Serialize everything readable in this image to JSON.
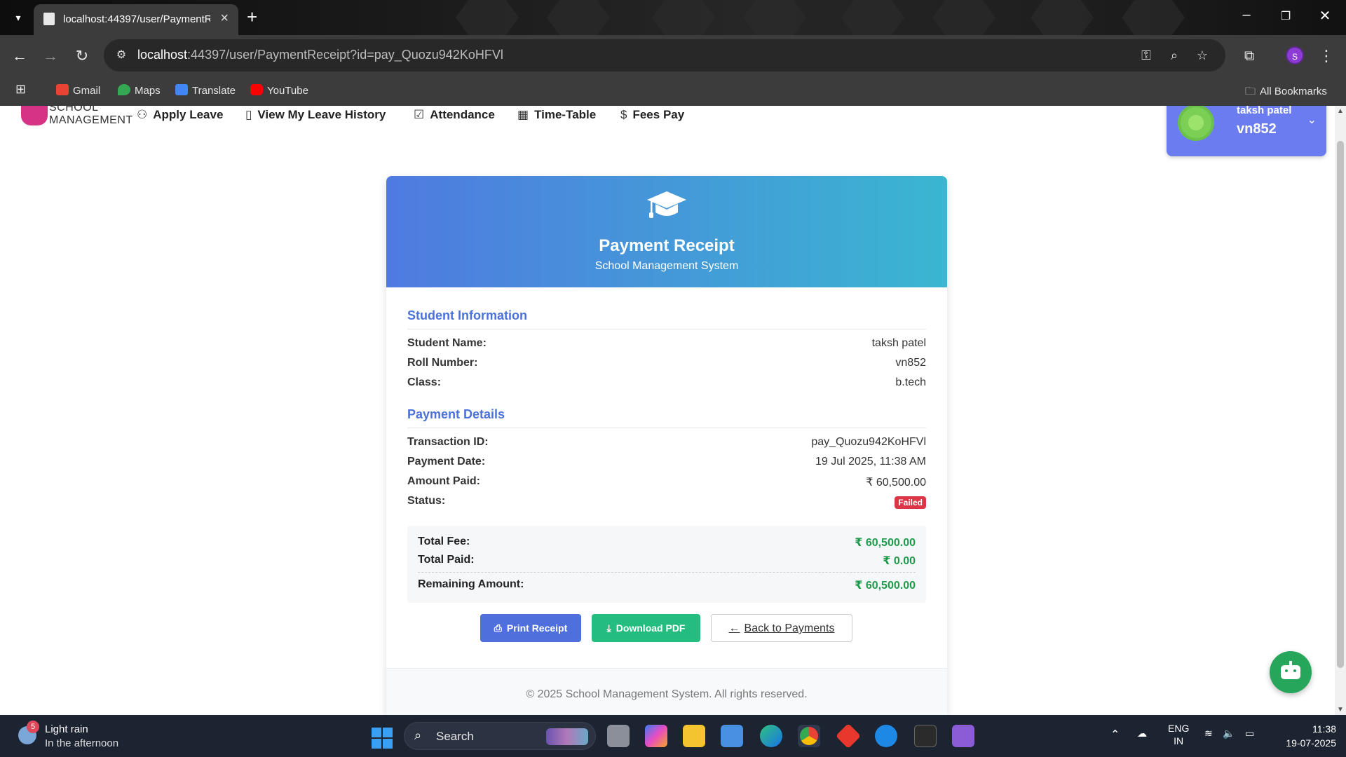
{
  "browser": {
    "tab_title": "localhost:44397/user/PaymentR",
    "url_host": "localhost",
    "url_rest": ":44397/user/PaymentReceipt?id=pay_Quozu942KoHFVl",
    "profile_initial": "S",
    "bookmarks": [
      "Gmail",
      "Maps",
      "Translate",
      "YouTube"
    ],
    "all_bookmarks": "All Bookmarks"
  },
  "app": {
    "logo_line1": "SCHOOL",
    "logo_line2": "MANAGEMENT",
    "nav": [
      {
        "icon": "person-icon",
        "label": "Apply Leave"
      },
      {
        "icon": "notebook-icon",
        "label": "View My Leave History"
      },
      {
        "icon": "checkbox-icon",
        "label": "Attendance"
      },
      {
        "icon": "calendar-icon",
        "label": "Time-Table"
      },
      {
        "icon": "dollar-icon",
        "label": "Fees Pay"
      }
    ],
    "user": {
      "name": "taksh patel",
      "roll": "vn852"
    }
  },
  "receipt": {
    "title": "Payment Receipt",
    "subtitle": "School Management System",
    "student_section": "Student Information",
    "student": [
      {
        "label": "Student Name:",
        "value": "taksh patel"
      },
      {
        "label": "Roll Number:",
        "value": "vn852"
      },
      {
        "label": "Class:",
        "value": "b.tech"
      }
    ],
    "payment_section": "Payment Details",
    "payment": [
      {
        "label": "Transaction ID:",
        "value": "pay_Quozu942KoHFVl"
      },
      {
        "label": "Payment Date:",
        "value": "19 Jul 2025, 11:38 AM"
      },
      {
        "label": "Amount Paid:",
        "value": "₹ 60,500.00"
      },
      {
        "label": "Status:",
        "value": "Failed"
      }
    ],
    "totals": [
      {
        "label": "Total Fee:",
        "value": "₹ 60,500.00"
      },
      {
        "label": "Total Paid:",
        "value": "₹ 0.00"
      },
      {
        "label": "Remaining Amount:",
        "value": "₹ 60,500.00"
      }
    ],
    "buttons": {
      "print": "Print Receipt",
      "pdf": "Download PDF",
      "back": "Back to Payments"
    },
    "footer": "© 2025 School Management System. All rights reserved."
  },
  "taskbar": {
    "weather_title": "Light rain",
    "weather_sub": "In the afternoon",
    "weather_badge": "5",
    "search": "Search",
    "lang1": "ENG",
    "lang2": "IN",
    "time": "11:38",
    "date": "19-07-2025"
  },
  "colors": {
    "accent": "#4a72d8",
    "success": "#1f9a4a",
    "danger": "#dc3545",
    "pdf_button": "#25bd7f",
    "print_button": "#4f6fdd"
  }
}
